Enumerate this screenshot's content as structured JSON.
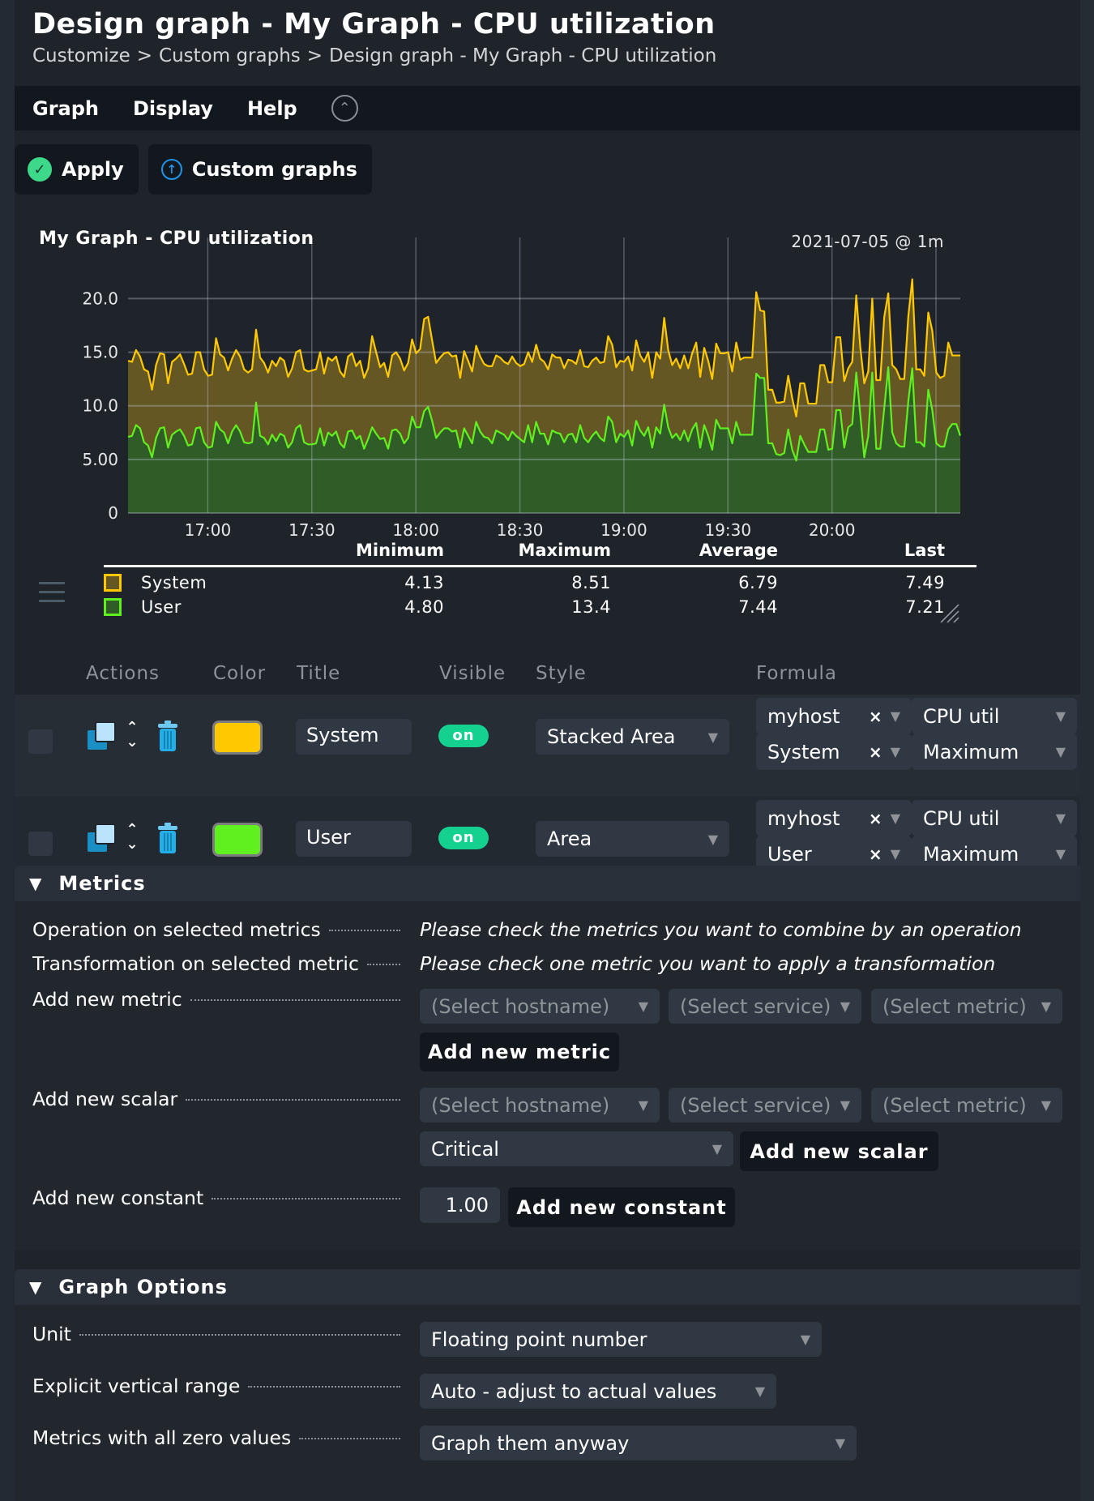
{
  "header": {
    "title": "Design graph - My Graph - CPU utilization",
    "breadcrumb": [
      "Customize",
      "Custom graphs",
      "Design graph - My Graph - CPU utilization"
    ],
    "breadcrumb_sep": ">"
  },
  "menu": {
    "items": [
      "Graph",
      "Display",
      "Help"
    ],
    "collapse_icon": "chevron-up-circle-icon"
  },
  "toolbar": {
    "apply_label": "Apply",
    "apply_icon": "check-circle-icon",
    "custom_graphs_label": "Custom graphs",
    "custom_graphs_icon": "arrow-up-circle-icon"
  },
  "graph": {
    "title": "My Graph - CPU utilization",
    "timestamp": "2021-07-05 @ 1m",
    "legend_headers": [
      "Minimum",
      "Maximum",
      "Average",
      "Last"
    ],
    "legend_rows": [
      {
        "name": "System",
        "color": "#ffc800",
        "fill": "#655723",
        "min": "4.13",
        "max": "8.51",
        "avg": "6.79",
        "last": "7.49"
      },
      {
        "name": "User",
        "color": "#60f020",
        "fill": "#2f5c27",
        "min": "4.80",
        "max": "13.4",
        "avg": "7.44",
        "last": "7.21"
      }
    ]
  },
  "chart_data": {
    "type": "area",
    "title": "My Graph - CPU utilization",
    "subtitle": "2021-07-05 @ 1m",
    "xlabel": "",
    "ylabel": "",
    "x_start": "16:37",
    "x_end": "20:37",
    "x_ticks": [
      "17:00",
      "17:30",
      "18:00",
      "18:30",
      "19:00",
      "19:30",
      "20:00"
    ],
    "y_ticks": [
      "0",
      "5.00",
      "10.0",
      "15.0",
      "20.0"
    ],
    "ylim": [
      0,
      22.3
    ],
    "grid": true,
    "stacked": true,
    "series": [
      {
        "name": "User",
        "style": "Area",
        "color": "#60f020",
        "values": [
          7.1,
          7.2,
          8.2,
          7.9,
          6.6,
          6.3,
          5.2,
          7.0,
          7.9,
          8.0,
          6.1,
          7.3,
          7.6,
          7.8,
          7.2,
          6.3,
          6.4,
          7.9,
          8.0,
          6.6,
          6.1,
          6.2,
          8.5,
          7.8,
          7.5,
          6.5,
          7.6,
          8.2,
          7.6,
          6.6,
          6.5,
          6.6,
          10.3,
          7.2,
          7.0,
          6.4,
          7.3,
          6.7,
          7.4,
          7.2,
          6.1,
          6.6,
          7.9,
          8.2,
          6.6,
          6.4,
          6.4,
          6.5,
          7.9,
          6.3,
          7.5,
          7.2,
          7.6,
          6.5,
          6.1,
          7.6,
          7.7,
          6.9,
          7.2,
          6.0,
          6.9,
          8.0,
          7.4,
          6.9,
          7.0,
          6.0,
          7.7,
          7.8,
          7.4,
          6.5,
          7.0,
          9.0,
          8.0,
          8.0,
          9.5,
          9.9,
          8.6,
          7.0,
          7.5,
          7.9,
          7.9,
          7.6,
          7.7,
          6.1,
          7.9,
          7.2,
          6.5,
          8.5,
          7.6,
          7.1,
          7.0,
          6.5,
          7.7,
          7.5,
          7.3,
          6.8,
          7.6,
          7.2,
          6.9,
          6.6,
          8.2,
          6.6,
          8.5,
          7.4,
          7.4,
          6.4,
          7.7,
          7.5,
          7.4,
          6.6,
          7.3,
          7.4,
          6.6,
          8.2,
          7.0,
          6.6,
          7.2,
          7.6,
          7.0,
          6.7,
          9.0,
          8.5,
          6.6,
          7.4,
          7.1,
          7.7,
          6.3,
          8.6,
          7.7,
          7.2,
          8.0,
          6.1,
          8.0,
          7.4,
          10.1,
          8.0,
          7.0,
          7.4,
          6.8,
          7.7,
          6.7,
          7.8,
          8.4,
          6.1,
          8.2,
          7.2,
          5.9,
          8.7,
          7.9,
          7.9,
          7.9,
          6.5,
          8.5,
          7.3,
          7.3,
          7.3,
          7.3,
          13.0,
          12.6,
          12.6,
          6.5,
          6.5,
          5.5,
          5.4,
          5.6,
          7.8,
          5.9,
          4.9,
          7.2,
          6.4,
          5.7,
          5.7,
          5.7,
          7.8,
          7.8,
          5.9,
          6.0,
          9.6,
          9.6,
          6.1,
          8.0,
          8.3,
          13.1,
          9.2,
          5.2,
          7.2,
          13.1,
          6.0,
          6.0,
          9.8,
          13.6,
          7.5,
          6.5,
          6.2,
          6.2,
          10.4,
          13.5,
          6.6,
          6.6,
          6.2,
          11.5,
          9.6,
          6.5,
          6.2,
          6.2,
          7.8,
          8.3,
          8.3,
          7.21
        ]
      },
      {
        "name": "System",
        "style": "Stacked Area",
        "color": "#ffc800",
        "values": [
          7.1,
          6.9,
          7.0,
          6.7,
          6.8,
          6.9,
          6.3,
          6.8,
          7.0,
          6.8,
          6.0,
          6.8,
          6.8,
          7.0,
          6.7,
          6.6,
          6.6,
          7.1,
          7.0,
          6.8,
          6.7,
          6.7,
          7.8,
          7.0,
          7.0,
          6.8,
          6.8,
          7.0,
          7.0,
          6.8,
          6.6,
          6.8,
          6.8,
          7.3,
          7.0,
          6.7,
          6.9,
          7.0,
          7.1,
          7.0,
          6.6,
          6.9,
          7.1,
          7.0,
          6.8,
          6.8,
          6.9,
          6.9,
          7.1,
          6.7,
          7.0,
          7.0,
          7.0,
          6.7,
          6.6,
          7.0,
          7.2,
          6.8,
          7.0,
          6.6,
          6.6,
          8.5,
          7.6,
          6.7,
          7.0,
          6.7,
          7.0,
          7.2,
          7.0,
          6.8,
          7.0,
          7.2,
          6.9,
          7.3,
          8.6,
          8.4,
          7.5,
          7.0,
          7.0,
          7.0,
          7.1,
          7.0,
          7.0,
          6.5,
          7.2,
          7.0,
          6.7,
          7.1,
          7.0,
          6.8,
          6.7,
          7.2,
          7.0,
          7.0,
          6.8,
          7.1,
          7.0,
          6.8,
          6.8,
          7.3,
          6.8,
          7.5,
          7.2,
          7.0,
          6.7,
          7.0,
          7.1,
          7.0,
          7.1,
          6.9,
          7.0,
          6.8,
          7.3,
          7.0,
          6.7,
          7.0,
          7.0,
          6.9,
          7.0,
          7.4,
          7.5,
          7.2,
          7.0,
          6.8,
          7.0,
          6.9,
          7.0,
          7.5,
          7.0,
          6.9,
          7.0,
          6.5,
          7.0,
          7.0,
          8.1,
          7.2,
          6.8,
          7.0,
          6.7,
          7.0,
          6.8,
          7.1,
          7.5,
          6.6,
          7.2,
          7.0,
          6.6,
          7.1,
          7.0,
          7.0,
          7.1,
          6.7,
          7.4,
          7.0,
          7.2,
          7.2,
          7.2,
          7.6,
          6.3,
          6.2,
          5.0,
          5.0,
          4.8,
          4.9,
          4.8,
          5.0,
          4.8,
          4.1,
          4.9,
          5.7,
          4.5,
          4.5,
          4.5,
          6.0,
          6.0,
          6.3,
          6.2,
          6.8,
          6.8,
          6.2,
          5.5,
          5.8,
          7.2,
          6.3,
          6.9,
          6.0,
          6.9,
          6.4,
          6.4,
          8.5,
          6.9,
          6.3,
          6.9,
          6.3,
          6.3,
          7.9,
          8.3,
          6.8,
          6.8,
          6.6,
          7.2,
          7.4,
          6.6,
          6.4,
          6.6,
          8.1,
          6.4,
          6.4,
          7.49
        ]
      }
    ]
  },
  "metrics_table": {
    "headers": [
      "Actions",
      "Color",
      "Title",
      "Visible",
      "Style",
      "Formula"
    ],
    "rows": [
      {
        "title": "System",
        "color": "#ffc800",
        "visible": "on",
        "style": "Stacked Area",
        "formula": {
          "host": "myhost",
          "service": "System",
          "metric": "CPU util",
          "consolidation": "Maximum"
        }
      },
      {
        "title": "User",
        "color": "#60f020",
        "visible": "on",
        "style": "Area",
        "formula": {
          "host": "myhost",
          "service": "User",
          "metric": "CPU util",
          "consolidation": "Maximum"
        }
      }
    ],
    "clear_glyph": "×"
  },
  "metrics_section": {
    "title": "Metrics",
    "operation_label": "Operation on selected metrics",
    "operation_hint": "Please check the metrics you want to combine by an operation",
    "transformation_label": "Transformation on selected metric",
    "transformation_hint": "Please check one metric you want to apply a transformation",
    "add_metric_label": "Add new metric",
    "add_metric_button": "Add new metric",
    "add_scalar_label": "Add new scalar",
    "add_scalar_button": "Add new scalar",
    "scalar_type": "Critical",
    "add_constant_label": "Add new constant",
    "add_constant_button": "Add new constant",
    "constant_value": "1.00",
    "host_placeholder": "(Select hostname)",
    "service_placeholder": "(Select service)",
    "metric_placeholder": "(Select metric)"
  },
  "graph_options": {
    "title": "Graph Options",
    "unit_label": "Unit",
    "unit_value": "Floating point number",
    "range_label": "Explicit vertical range",
    "range_value": "Auto - adjust to actual values",
    "zero_label": "Metrics with all zero values",
    "zero_value": "Graph them anyway"
  }
}
